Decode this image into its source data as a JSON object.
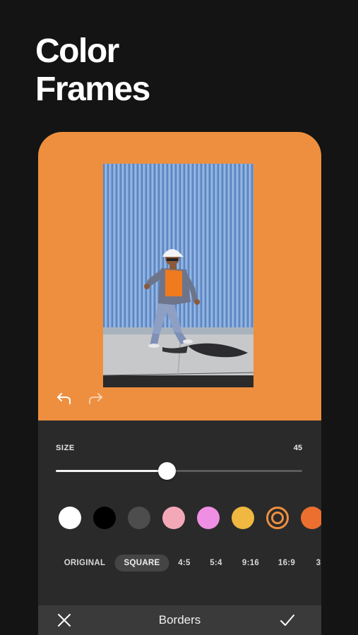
{
  "headline": {
    "line1": "Color",
    "line2": "Frames"
  },
  "canvas": {
    "frame_color": "#ee8f3f"
  },
  "controls": {
    "undo_icon": "undo-arrow-icon",
    "redo_icon": "redo-arrow-icon"
  },
  "size": {
    "label": "SIZE",
    "value": "45",
    "slider_fraction": 0.45
  },
  "swatches": [
    {
      "name": "white",
      "color": "#ffffff",
      "selected": false
    },
    {
      "name": "black",
      "color": "#000000",
      "selected": false
    },
    {
      "name": "dark-gray",
      "color": "#4d4d4d",
      "selected": false
    },
    {
      "name": "light-pink",
      "color": "#f3a8b8",
      "selected": false
    },
    {
      "name": "violet-pink",
      "color": "#ee8fe3",
      "selected": false
    },
    {
      "name": "yellow",
      "color": "#f0b840",
      "selected": false
    },
    {
      "name": "orange",
      "color": "#ee8f3f",
      "selected": true
    },
    {
      "name": "deep-orange",
      "color": "#ec6f2f",
      "selected": false
    }
  ],
  "ratios": [
    {
      "label": "ORIGINAL",
      "active": false
    },
    {
      "label": "SQUARE",
      "active": true
    },
    {
      "label": "4:5",
      "active": false
    },
    {
      "label": "5:4",
      "active": false
    },
    {
      "label": "9:16",
      "active": false
    },
    {
      "label": "16:9",
      "active": false
    },
    {
      "label": "3:",
      "active": false
    }
  ],
  "bottom_bar": {
    "title": "Borders",
    "cancel_icon": "close-icon",
    "confirm_icon": "checkmark-icon"
  }
}
